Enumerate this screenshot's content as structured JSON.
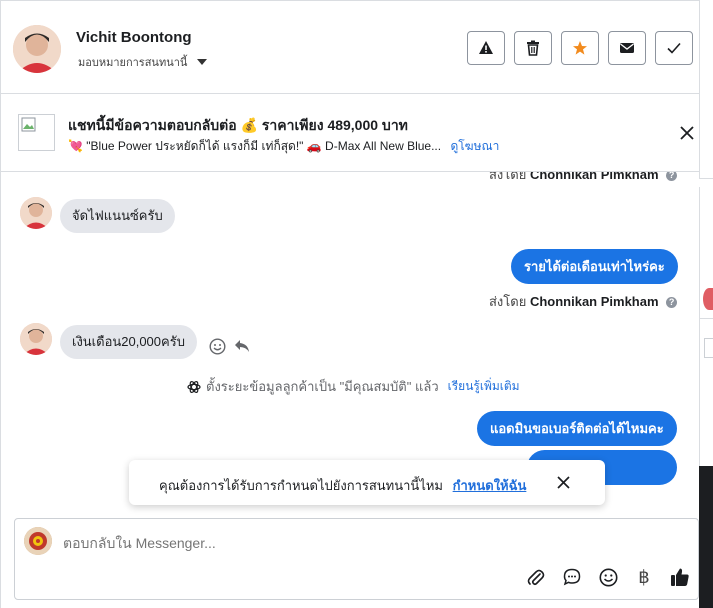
{
  "header": {
    "contact_name": "Vichit Boontong",
    "assign_label": "มอบหมายการสนทนานี้",
    "actions": [
      {
        "icon": "alert-icon",
        "color": "#1c1e21"
      },
      {
        "icon": "trash-icon",
        "color": "#1c1e21"
      },
      {
        "icon": "star-icon",
        "color": "#f28b1e"
      },
      {
        "icon": "envelope-icon",
        "color": "#1c1e21"
      },
      {
        "icon": "check-icon",
        "color": "#1c1e21"
      }
    ]
  },
  "ad": {
    "title": "แชทนี้มีข้อความตอบกลับต่อ 💰 ราคาเพียง 489,000 บาท",
    "subtitle": "💘 \"Blue Power ประหยัดก็ได้ แรงก็มี เท่ก็สุด!\" 🚗 D-Max All New Blue...",
    "link": "ดูโฆษณา"
  },
  "messages": {
    "sent_by_prefix": "ส่งโดย",
    "agent_name": "Chonnikan Pimkham",
    "m1": "จัดไฟแนนซ์ครับ",
    "m2": "รายได้ต่อเดือนเท่าไหร่คะ",
    "m3": "เงินเดือน20,000ครับ",
    "system_note": "ตั้งระยะข้อมูลลูกค้าเป็น \"มีคุณสมบัติ\" แล้ว",
    "system_link": "เรียนรู้เพิ่มเติม",
    "m4": "แอดมินขอเบอร์ติดต่อได้ไหมคะ"
  },
  "toast": {
    "text": "คุณต้องการได้รับการกำหนดไปยังการสนทนานี้ไหม",
    "link": "กำหนดให้ฉัน"
  },
  "composer": {
    "placeholder": "ตอบกลับใน Messenger...",
    "baht_symbol": "฿"
  },
  "colors": {
    "accent": "#1b74e4",
    "incoming_bubble": "#e4e6eb",
    "link": "#216fdb"
  }
}
